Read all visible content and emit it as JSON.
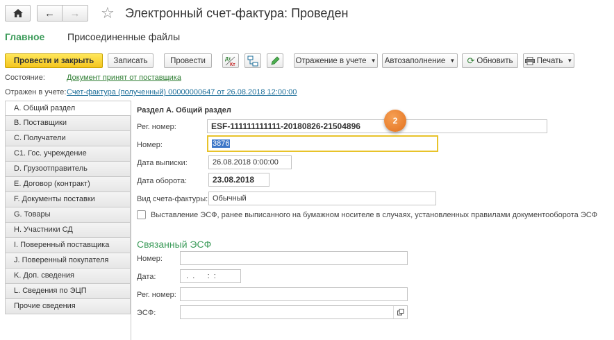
{
  "window": {
    "title": "Электронный счет-фактура: Проведен"
  },
  "nav": {
    "tab_main": "Главное",
    "tab_files": "Присоединенные файлы"
  },
  "toolbar": {
    "post_close": "Провести и закрыть",
    "save": "Записать",
    "post": "Провести",
    "reflection": "Отражение в учете",
    "autofill": "Автозаполнение",
    "refresh": "Обновить",
    "print": "Печать",
    "dtkt_label": "Дт Кт"
  },
  "status": {
    "state_label": "Состояние:",
    "state_value": "Документ принят от поставщика",
    "reflected_label": "Отражен в учете:",
    "reflected_value": "Счет-фактура (полученный) 00000000647 от 26.08.2018 12:00:00"
  },
  "sidebar": {
    "items": [
      "A. Общий раздел",
      "B. Поставщики",
      "C. Получатели",
      "C1. Гос. учреждение",
      "D. Грузоотправитель",
      "E. Договор (контракт)",
      "F. Документы поставки",
      "G. Товары",
      "H. Участники СД",
      "I. Поверенный поставщика",
      "J. Поверенный покупателя",
      "K. Доп. сведения",
      "L. Сведения по ЭЦП",
      "Прочие сведения"
    ]
  },
  "form": {
    "section_title": "Раздел А. Общий раздел",
    "reg_label": "Рег. номер:",
    "reg_value": "ESF-111111111111-20180826-21504896",
    "number_label": "Номер:",
    "number_value": "3876",
    "issue_date_label": "Дата выписки:",
    "issue_date_value": "26.08.2018  0:00:00",
    "turnover_date_label": "Дата оборота:",
    "turnover_date_value": "23.08.2018",
    "type_label": "Вид счета-фактуры:",
    "type_value": "Обычный",
    "checkbox_label": "Выставление ЭСФ, ранее выписанного на бумажном носителе в случаях, установленных правилами документооборота ЭСФ",
    "badge": "2"
  },
  "linked": {
    "title": "Связанный ЭСФ",
    "number_label": "Номер:",
    "date_label": "Дата:",
    "date_value": " .  .      :  :",
    "reg_label": "Рег. номер:",
    "esf_label": "ЭСФ:"
  }
}
